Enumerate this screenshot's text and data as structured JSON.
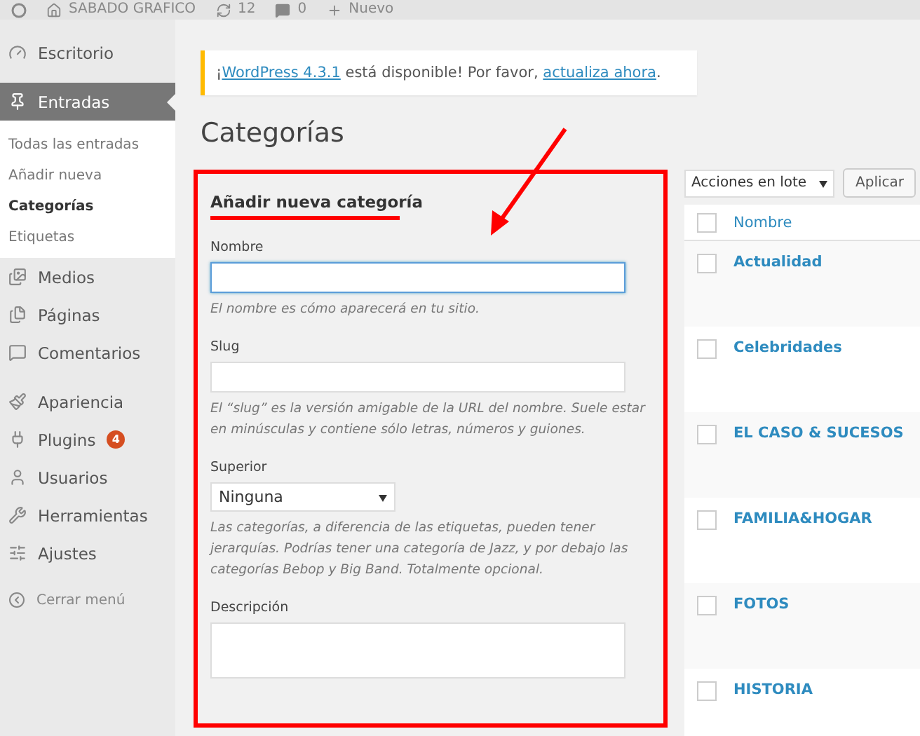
{
  "admin_bar": {
    "site": "SABADO GRAFICO",
    "updates": "12",
    "comments": "0",
    "new": "Nuevo"
  },
  "sidebar": {
    "sections": [
      {
        "items": [
          {
            "label": "Escritorio",
            "selected": false
          }
        ]
      },
      {
        "items": [
          {
            "label": "Entradas",
            "selected": true,
            "children": [
              {
                "label": "Todas las entradas",
                "selected": false
              },
              {
                "label": "Añadir nueva",
                "selected": false
              },
              {
                "label": "Categorías",
                "selected": true
              },
              {
                "label": "Etiquetas",
                "selected": false
              }
            ]
          },
          {
            "label": "Medios",
            "selected": false
          },
          {
            "label": "Páginas",
            "selected": false
          },
          {
            "label": "Comentarios",
            "selected": false
          }
        ]
      },
      {
        "items": [
          {
            "label": "Apariencia",
            "selected": false
          },
          {
            "label": "Plugins",
            "selected": false,
            "badge": "4"
          },
          {
            "label": "Usuarios",
            "selected": false
          },
          {
            "label": "Herramientas",
            "selected": false
          },
          {
            "label": "Ajustes",
            "selected": false
          }
        ]
      }
    ],
    "collapse": "Cerrar menú"
  },
  "notice": {
    "prefix": "¡",
    "version_link": "WordPress 4.3.1",
    "middle": " está disponible! Por favor, ",
    "update_link": "actualiza ahora",
    "end": "."
  },
  "page_title": "Categorías",
  "form": {
    "heading": "Añadir nueva categoría",
    "fields": [
      {
        "kind": "input",
        "label": "Nombre",
        "focused": true,
        "help": "El nombre es cómo aparecerá en tu sitio."
      },
      {
        "kind": "input",
        "label": "Slug",
        "focused": false,
        "help": "El “slug” es la versión amigable de la URL del nombre. Suele estar en minúsculas y contiene sólo letras, números y guiones."
      },
      {
        "kind": "select",
        "label": "Superior",
        "value": "Ninguna",
        "help": "Las categorías, a diferencia de las etiquetas, pueden tener jerarquías. Podrías tener una categoría de Jazz, y por debajo las categorías Bebop y Big Band. Totalmente opcional."
      },
      {
        "kind": "textarea",
        "label": "Descripción"
      }
    ]
  },
  "bulk_actions": {
    "select": "Acciones en lote",
    "button": "Aplicar"
  },
  "table": {
    "select_all_checked": false,
    "columns": [
      "Nombre"
    ],
    "rows": [
      {
        "name": "Actualidad",
        "checked": false
      },
      {
        "name": "Celebridades",
        "checked": false
      },
      {
        "name": "EL CASO & SUCESOS",
        "checked": false
      },
      {
        "name": "FAMILIA&HOGAR",
        "checked": false
      },
      {
        "name": "FOTOS",
        "checked": false
      },
      {
        "name": "HISTORIA",
        "checked": false
      }
    ]
  }
}
